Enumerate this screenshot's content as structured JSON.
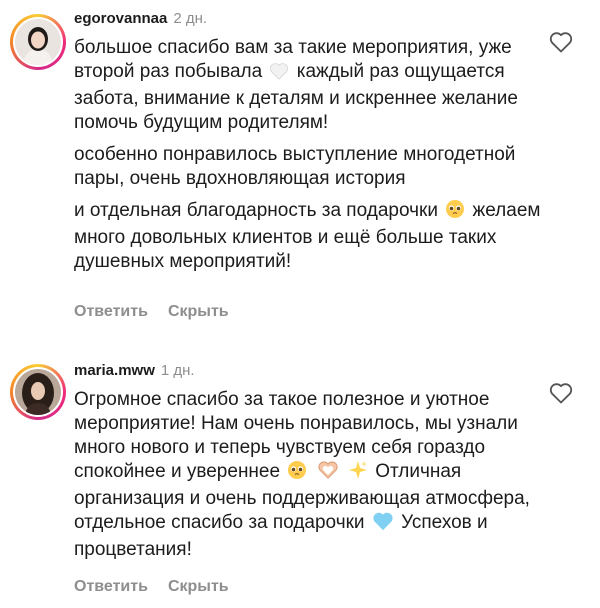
{
  "comments": [
    {
      "username": "egorovannaa",
      "time": "2 дн.",
      "paragraphs": [
        {
          "before": "большое спасибо вам за такие мероприятия, уже второй раз побывала",
          "after": "каждый раз ощущается забота, внимание к деталям и искреннее желание помочь будущим родителям!"
        },
        {
          "text": "особенно понравилось выступление многодетной пары, очень вдохновляющая история"
        },
        {
          "before": "и отдельная благодарность за подарочки",
          "after": "желаем много довольных клиентов и ещё больше таких душевных мероприятий!"
        }
      ],
      "reply_label": "Ответить",
      "hide_label": "Скрыть",
      "icons": [
        "white-heart-emoji",
        "pleading-face-emoji",
        "heart-outline-icon"
      ]
    },
    {
      "username": "maria.mww",
      "time": "1 дн.",
      "paragraphs": [
        {
          "before": "Огромное спасибо за такое полезное и уютное мероприятие! Нам очень понравилось, мы узнали много нового и теперь чувствуем себя гораздо спокойнее и увереннее",
          "after": "Отличная организация и очень поддерживающая атмосфера, отдельное спасибо за подарочки",
          "last": "Успехов и процветания!"
        }
      ],
      "reply_label": "Ответить",
      "hide_label": "Скрыть",
      "icons": [
        "pleading-face-emoji",
        "heart-hands-emoji",
        "sparkles-emoji",
        "light-blue-heart-emoji",
        "heart-outline-icon"
      ]
    }
  ],
  "colors": {
    "text": "#1c1c1c",
    "muted": "#8e8e8e",
    "ring_start": "#f9ce34",
    "ring_mid": "#ee2a7b"
  }
}
